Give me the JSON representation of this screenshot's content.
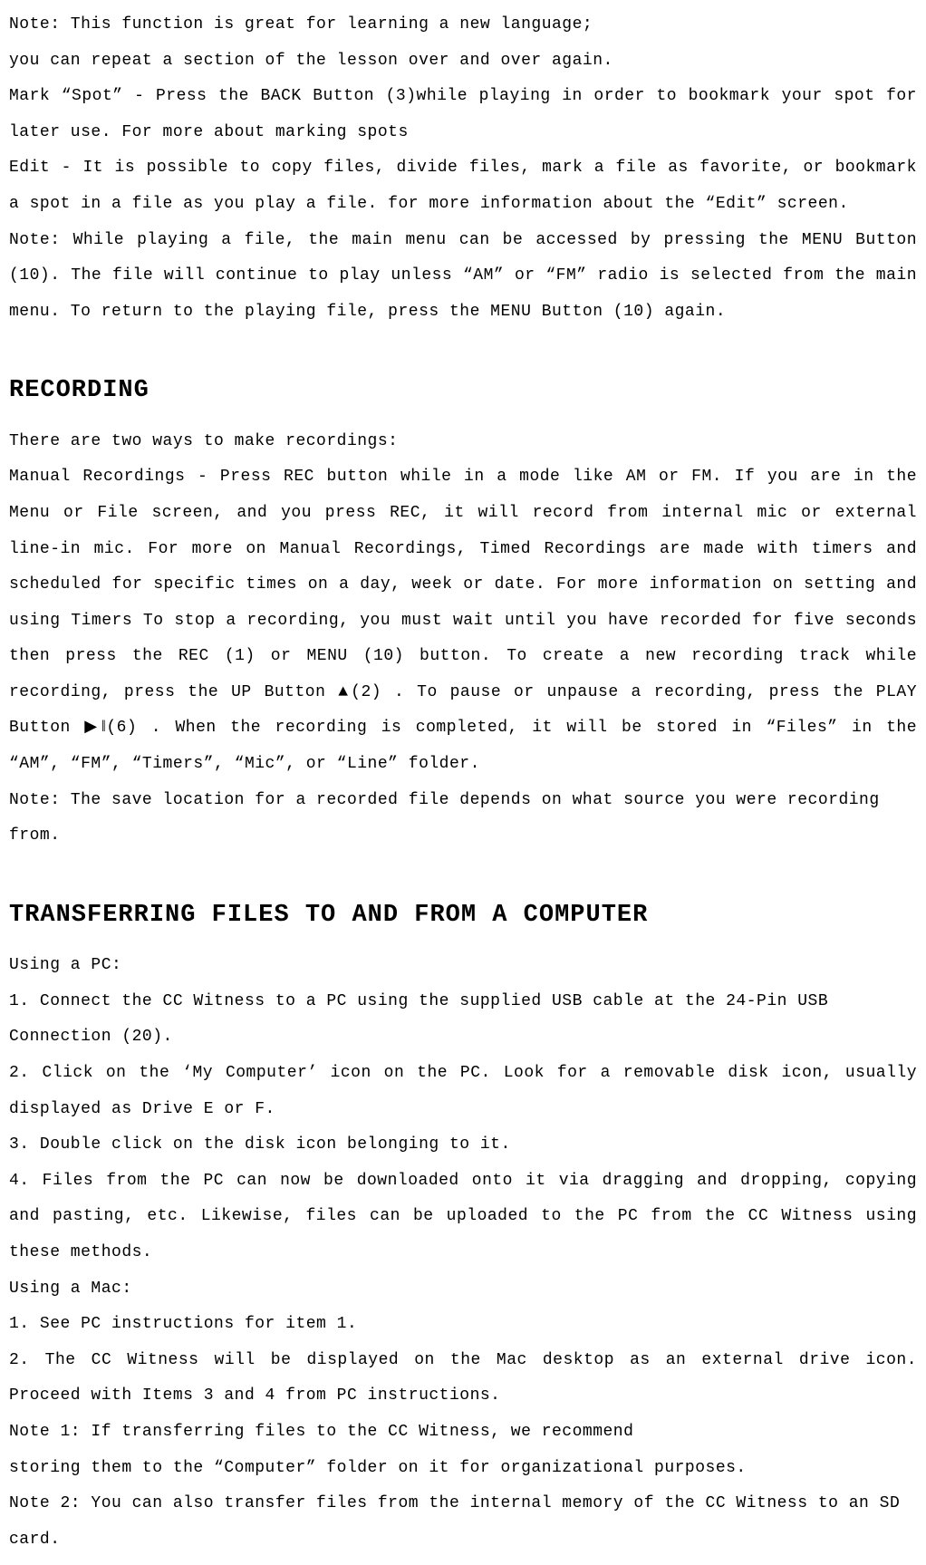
{
  "section1": {
    "p1": "Note: This function is great for learning a new language;",
    "p2": "you can repeat a section of the lesson over and over again.",
    "p3": "Mark “Spot” - Press the BACK Button (3)while playing in order to bookmark your spot for later use. For more about marking spots",
    "p4": "Edit - It is possible to copy files, divide files, mark a file as favorite, or bookmark a spot in a file as you play a file. for more information about the “Edit” screen.",
    "p5": "Note: While playing a file, the main menu can be accessed by pressing the MENU Button (10). The file will continue to play unless “AM” or “FM” radio is selected from the main menu. To return to the playing file, press the MENU Button (10) again."
  },
  "section2": {
    "heading": "RECORDING",
    "p1": "There are two ways to make recordings:",
    "p2": "Manual Recordings - Press REC button while in a mode like AM or FM. If you are in the Menu or File screen, and you press REC, it will record from internal mic or external line-in mic. For more on Manual Recordings, Timed Recordings are made with timers and scheduled for specific times on a day, week or date. For more information on setting and using Timers To stop a recording, you must wait until you have recorded for five seconds then press the REC (1) or MENU (10) button. To create a new recording track while recording, press the UP Button ▲(2) . To pause or unpause a recording, press the PLAY Button ▶‖(6) . When the recording is completed, it will be stored in “Files” in the “AM”, “FM”, “Timers”, “Mic”, or “Line” folder.",
    "p3": "Note: The save location for a recorded file depends on what source you were recording from."
  },
  "section3": {
    "heading": "TRANSFERRING FILES TO AND FROM A COMPUTER",
    "p1": "Using a PC:",
    "p2": "1. Connect the CC Witness to a PC using the supplied USB cable at the 24-Pin USB Connection (20).",
    "p3": "2. Click on the ‘My Computer’ icon on the PC. Look for a removable disk icon, usually displayed as Drive E or F.",
    "p4": "3. Double click on the disk icon belonging to it.",
    "p5": "4. Files from the PC can now be downloaded onto it via dragging and dropping, copying and pasting, etc. Likewise, files can be uploaded to the PC from the CC Witness using these methods.",
    "p6": "Using a Mac:",
    "p7": "1. See PC instructions for item 1.",
    "p8": "2. The CC Witness will be displayed on the Mac desktop as an external drive icon. Proceed with Items 3 and 4 from PC instructions.",
    "p9": "Note 1: If transferring files to the CC Witness, we recommend",
    "p10": "storing them to the “Computer” folder on it for organizational purposes.",
    "p11": "Note 2: You can also transfer files from the internal memory of the CC Witness to an SD card."
  }
}
